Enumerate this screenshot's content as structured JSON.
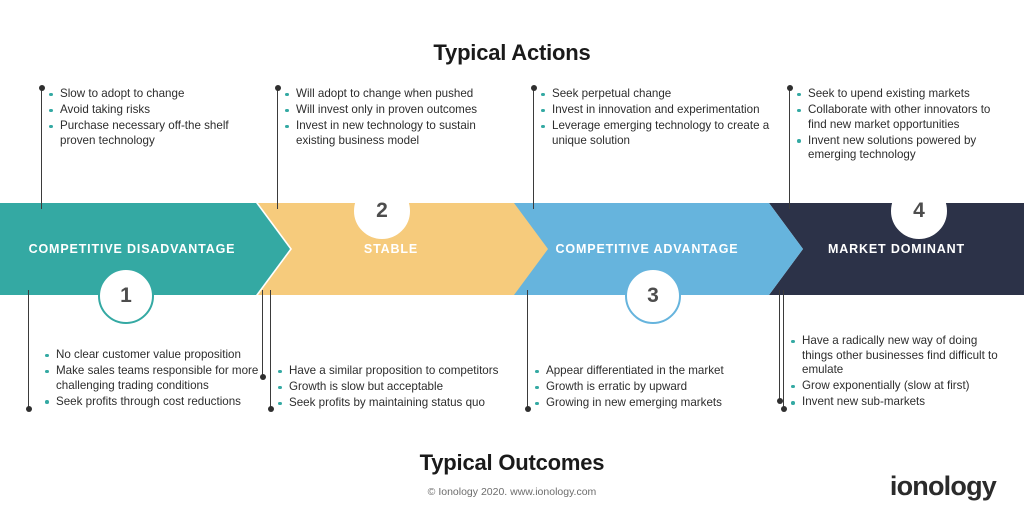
{
  "header": {
    "actions_title": "Typical Actions",
    "outcomes_title": "Typical Outcomes",
    "copyright": "© Ionology 2020. www.ionology.com",
    "logo": "ionology"
  },
  "colors": {
    "teal": "#34a9a3",
    "yellow": "#f6cb7c",
    "blue": "#66b4dd",
    "navy": "#2c3248",
    "bullet": "#34a9a3",
    "text": "#2d2d2d",
    "number": "#4d4d4d"
  },
  "stages": [
    {
      "number": "1",
      "label": "COMPETITIVE DISADVANTAGE",
      "color": "#34a9a3",
      "actions": [
        "Slow to adopt to change",
        "Avoid taking risks",
        "Purchase necessary off-the shelf proven technology"
      ],
      "outcomes": [
        "No clear customer value proposition",
        "Make sales teams responsible for more challenging trading conditions",
        "Seek profits through cost reductions"
      ]
    },
    {
      "number": "2",
      "label": "STABLE",
      "color": "#f6cb7c",
      "actions": [
        "Will adopt to change when pushed",
        "Will invest only in proven outcomes",
        "Invest in new technology to sustain existing business model"
      ],
      "outcomes": [
        "Have a similar proposition to competitors",
        "Growth is slow but acceptable",
        "Seek profits by maintaining status quo"
      ]
    },
    {
      "number": "3",
      "label": "COMPETITIVE ADVANTAGE",
      "color": "#66b4dd",
      "actions": [
        "Seek perpetual change",
        "Invest in innovation and experimentation",
        "Leverage emerging technology to create a unique solution"
      ],
      "outcomes": [
        "Appear differentiated in the market",
        "Growth is erratic by upward",
        "Growing in new emerging markets"
      ]
    },
    {
      "number": "4",
      "label": "MARKET DOMINANT",
      "color": "#2c3248",
      "actions": [
        "Seek to upend existing markets",
        "Collaborate with other innovators to find new market opportunities",
        "Invent new solutions powered by emerging technology"
      ],
      "outcomes": [
        "Have a radically new way of doing things other businesses find difficult to emulate",
        "Grow exponentially (slow at first)",
        "Invent new sub-markets"
      ]
    }
  ]
}
